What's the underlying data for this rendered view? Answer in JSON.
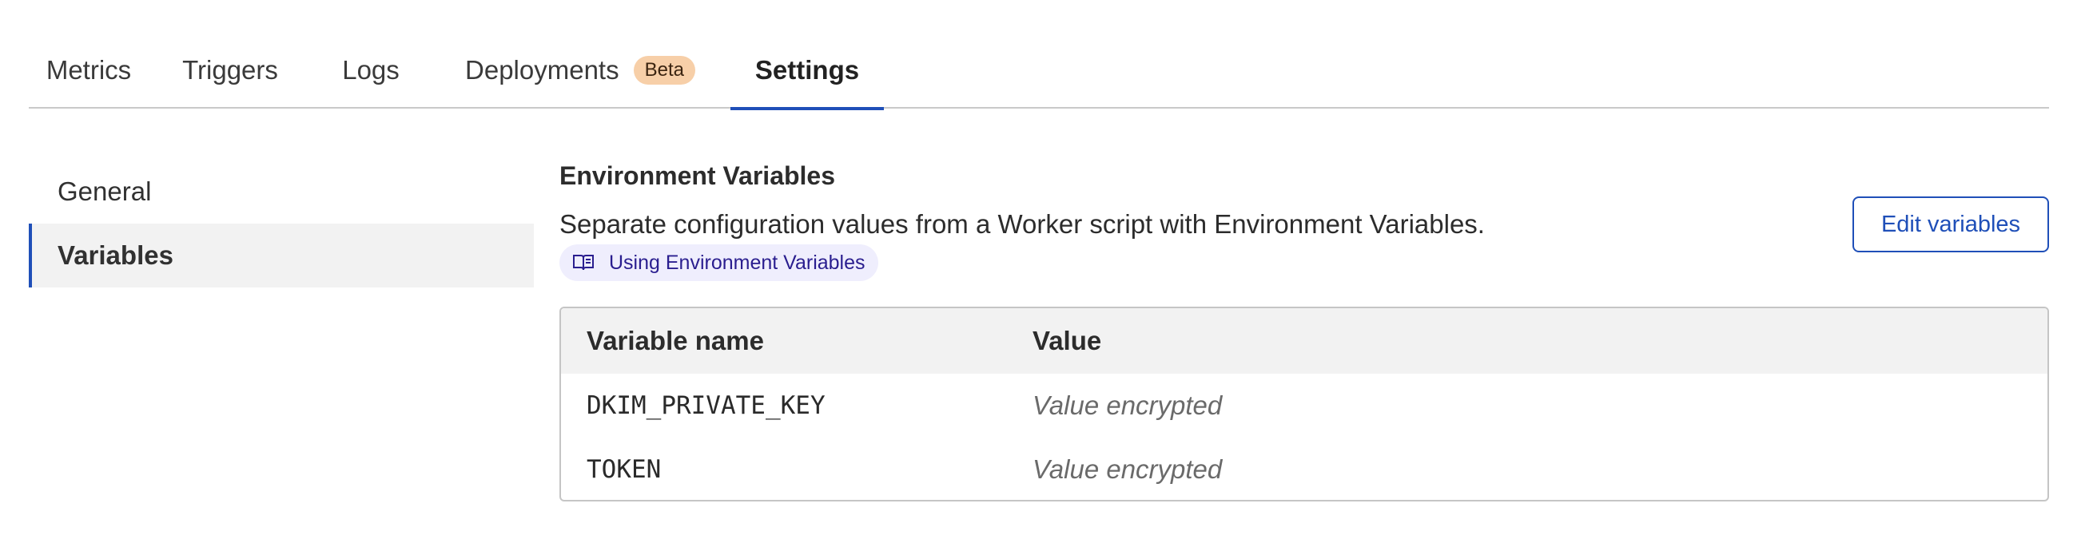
{
  "tabs": [
    {
      "label": "Metrics"
    },
    {
      "label": "Triggers"
    },
    {
      "label": "Logs"
    },
    {
      "label": "Deployments",
      "badge": "Beta"
    },
    {
      "label": "Settings",
      "active": true
    }
  ],
  "sidenav": {
    "items": [
      {
        "label": "General"
      },
      {
        "label": "Variables",
        "active": true
      }
    ]
  },
  "env": {
    "title": "Environment Variables",
    "description": "Separate configuration values from a Worker script with Environment Variables.",
    "doc_link": "Using Environment Variables",
    "doc_icon": "book-icon",
    "edit_button": "Edit variables"
  },
  "table": {
    "headers": [
      "Variable name",
      "Value"
    ],
    "rows": [
      {
        "name": "DKIM_PRIVATE_KEY",
        "value": "Value encrypted"
      },
      {
        "name": "TOKEN",
        "value": "Value encrypted"
      }
    ]
  },
  "colors": {
    "accent": "#1f4fb8",
    "badge_bg": "#f7cfa8",
    "link_bg": "#efeefd",
    "link_text": "#2a1e8f"
  }
}
